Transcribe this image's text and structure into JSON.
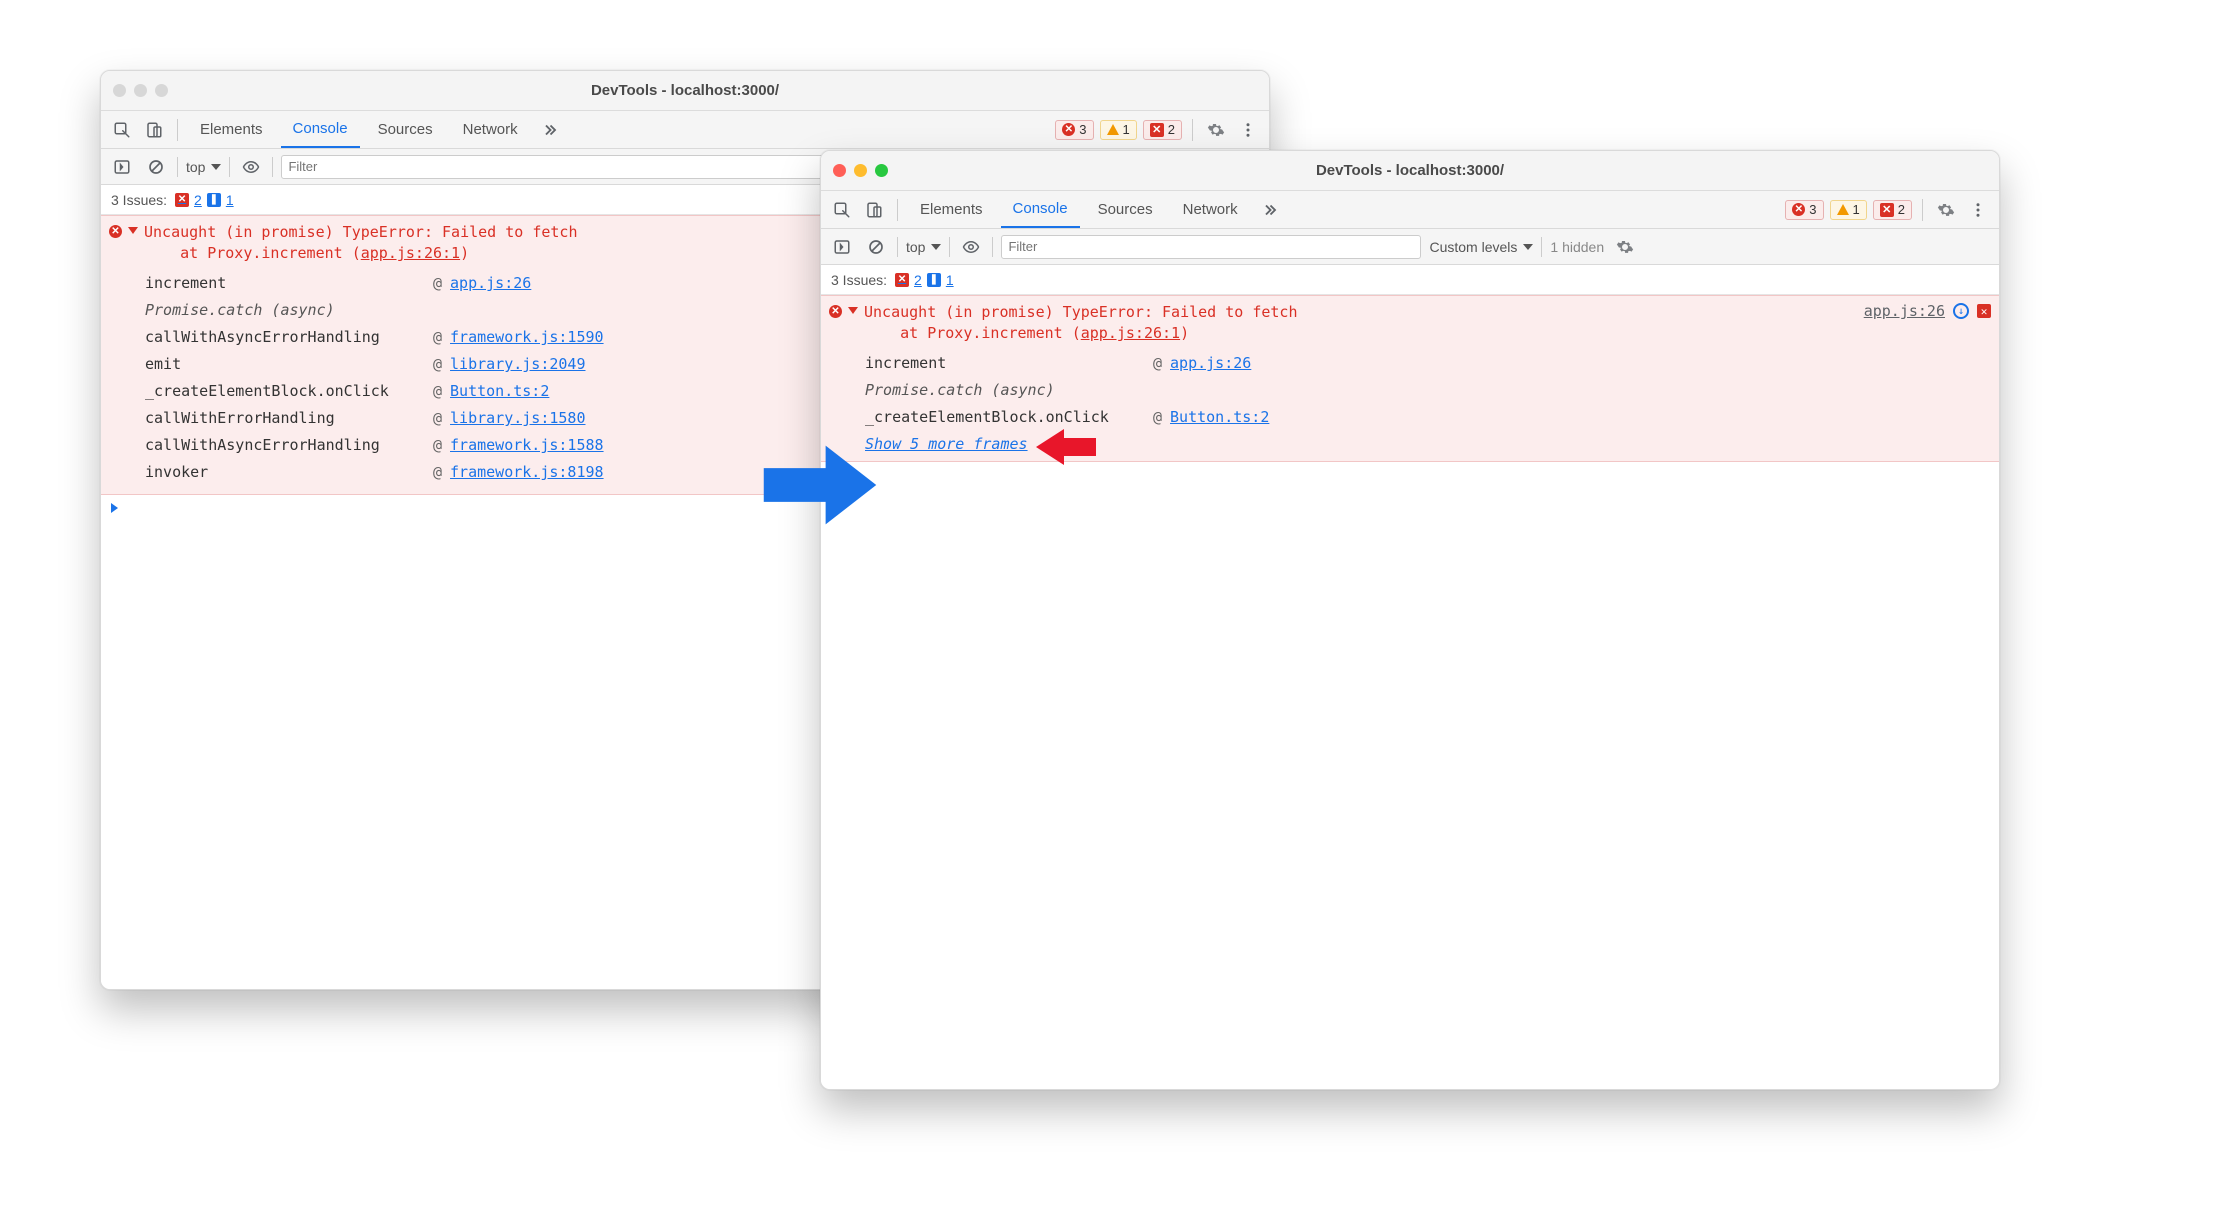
{
  "window1": {
    "title": "DevTools - localhost:3000/",
    "traffic_active": false,
    "tabs": [
      "Elements",
      "Console",
      "Sources",
      "Network"
    ],
    "active_tab_index": 1,
    "badges": {
      "errors": "3",
      "warnings": "1",
      "closed": "2"
    },
    "toolbar": {
      "context": "top",
      "filter_placeholder": "Filter"
    },
    "issues": {
      "label": "3 Issues:",
      "red": "2",
      "blue": "1"
    },
    "error": {
      "headline_pre": "Uncaught (in promise) TypeError: Failed to fetch",
      "headline_at": "at Proxy.increment (",
      "headline_link": "app.js:26:1",
      "headline_post": ")",
      "frames": [
        {
          "fn": "increment",
          "link": "app.js:26"
        },
        {
          "fn": "Promise.catch (async)",
          "async": true
        },
        {
          "fn": "callWithAsyncErrorHandling",
          "link": "framework.js:1590"
        },
        {
          "fn": "emit",
          "link": "library.js:2049"
        },
        {
          "fn": "_createElementBlock.onClick",
          "link": "Button.ts:2"
        },
        {
          "fn": "callWithErrorHandling",
          "link": "library.js:1580"
        },
        {
          "fn": "callWithAsyncErrorHandling",
          "link": "framework.js:1588"
        },
        {
          "fn": "invoker",
          "link": "framework.js:8198"
        }
      ]
    }
  },
  "window2": {
    "title": "DevTools - localhost:3000/",
    "traffic_active": true,
    "tabs": [
      "Elements",
      "Console",
      "Sources",
      "Network"
    ],
    "active_tab_index": 1,
    "badges": {
      "errors": "3",
      "warnings": "1",
      "closed": "2"
    },
    "toolbar": {
      "context": "top",
      "filter_placeholder": "Filter",
      "levels": "Custom levels",
      "hidden": "1 hidden"
    },
    "issues": {
      "label": "3 Issues:",
      "red": "2",
      "blue": "1"
    },
    "error": {
      "headline_pre": "Uncaught (in promise) TypeError: Failed to fetch",
      "headline_at": "at Proxy.increment (",
      "headline_link": "app.js:26:1",
      "headline_post": ")",
      "right_link": "app.js:26",
      "frames": [
        {
          "fn": "increment",
          "link": "app.js:26"
        },
        {
          "fn": "Promise.catch (async)",
          "async": true
        },
        {
          "fn": "_createElementBlock.onClick",
          "link": "Button.ts:2"
        }
      ],
      "show_more": "Show 5 more frames"
    }
  }
}
